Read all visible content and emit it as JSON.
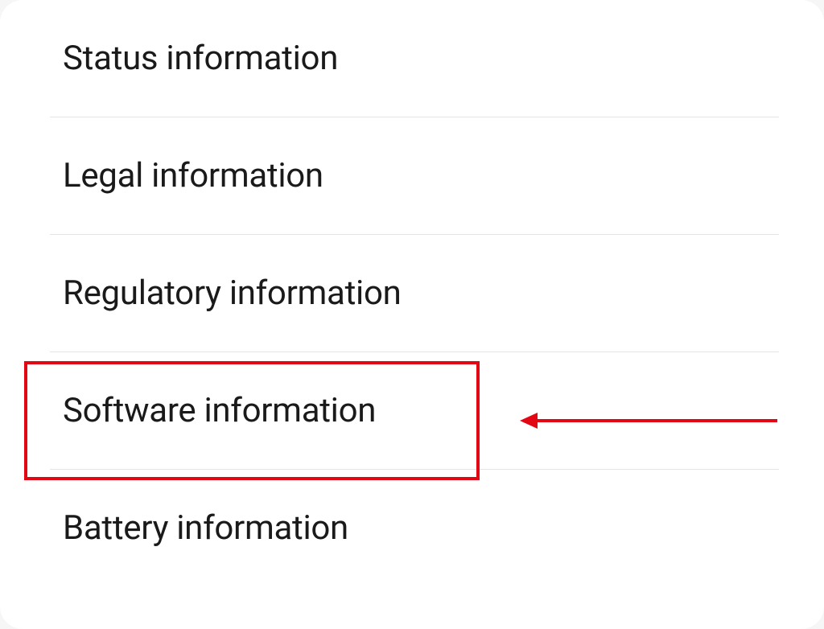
{
  "menu": {
    "items": [
      {
        "label": "Status information"
      },
      {
        "label": "Legal information"
      },
      {
        "label": "Regulatory information"
      },
      {
        "label": "Software information"
      },
      {
        "label": "Battery information"
      }
    ]
  },
  "annotation": {
    "highlight_color": "#e30613",
    "highlighted_index": 3
  }
}
